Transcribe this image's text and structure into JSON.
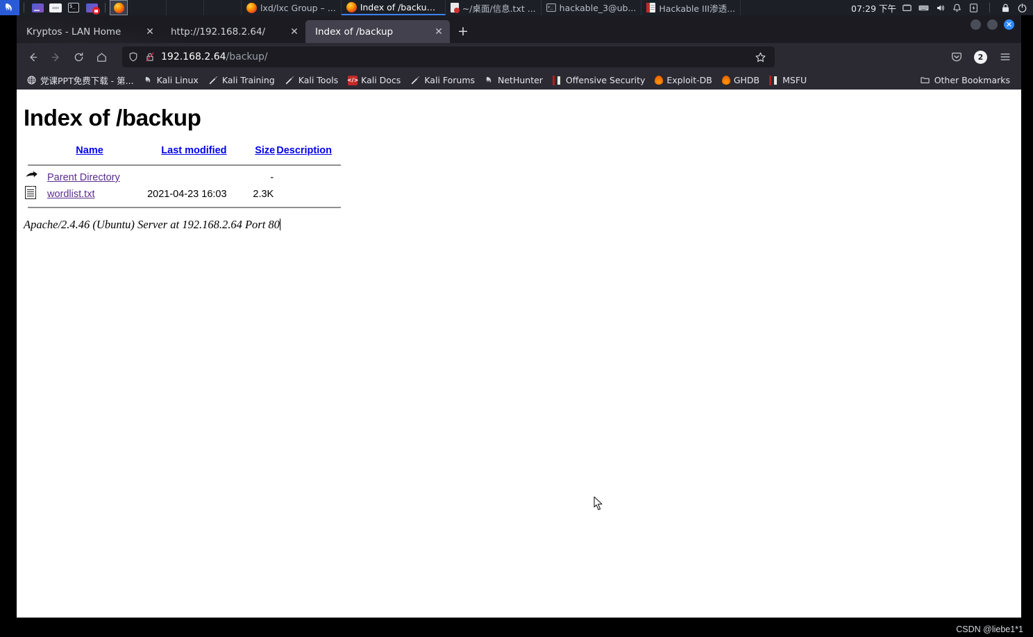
{
  "taskbar": {
    "menu_icon": "kali-dragon-icon",
    "launchers": [
      {
        "name": "file-manager",
        "icon": "files-icon"
      },
      {
        "name": "text-editor",
        "icon": "text-editor-icon"
      },
      {
        "name": "terminal",
        "icon": "terminal-icon"
      },
      {
        "name": "screen-recorder",
        "icon": "recorder-icon"
      },
      {
        "name": "firefox",
        "icon": "firefox-icon",
        "active": true
      }
    ],
    "windows": [
      {
        "label": "",
        "icon": "none",
        "empty": true
      },
      {
        "label": "",
        "icon": "none",
        "empty": true
      },
      {
        "label": "",
        "icon": "none",
        "empty": true
      },
      {
        "label": "lxd/lxc Group – ...",
        "icon": "firefox-icon",
        "active": false
      },
      {
        "label": "Index of /backup...",
        "icon": "firefox-icon",
        "active": true
      },
      {
        "label": "~/桌面/信息.txt ...",
        "icon": "pdf-icon",
        "active": false
      },
      {
        "label": "hackable_3@ub...",
        "icon": "terminal-icon",
        "active": false
      },
      {
        "label": "Hackable III渗透...",
        "icon": "document-icon",
        "active": false
      }
    ],
    "clock": "07:29 下午",
    "tray": [
      {
        "name": "network-icon"
      },
      {
        "name": "keyboard-icon"
      },
      {
        "name": "volume-icon"
      },
      {
        "name": "notifications-bell-icon"
      },
      {
        "name": "power-icon"
      },
      {
        "name": "lock-icon"
      },
      {
        "name": "logout-icon"
      }
    ]
  },
  "browser": {
    "tabs": [
      {
        "title": "Kryptos - LAN Home",
        "active": false,
        "close_label": "✕"
      },
      {
        "title": "http://192.168.2.64/",
        "active": false,
        "close_label": "✕"
      },
      {
        "title": "Index of /backup",
        "active": true,
        "close_label": "✕"
      }
    ],
    "new_tab_label": "+",
    "window_controls": {
      "minimize": "",
      "maximize": "",
      "close": "✕"
    },
    "nav": {
      "back_icon": "back-arrow-icon",
      "forward_icon": "forward-arrow-icon",
      "reload_icon": "reload-icon",
      "home_icon": "home-icon"
    },
    "url": {
      "shield_icon": "shield-icon",
      "lock_icon": "lock-crossed-icon",
      "domain": "192.168.2.64",
      "path": "/backup/",
      "star_icon": "bookmark-star-icon"
    },
    "nav_right": {
      "pocket_icon": "pocket-icon",
      "account_badge": "2",
      "menu_icon": "hamburger-menu-icon"
    },
    "bookmarks": [
      {
        "label": "党课PPT免费下载 - 第...",
        "icon": "globe-icon"
      },
      {
        "label": "Kali Linux",
        "icon": "kali-dragon-icon"
      },
      {
        "label": "Kali Training",
        "icon": "kali-tool-icon"
      },
      {
        "label": "Kali Tools",
        "icon": "kali-tool-icon"
      },
      {
        "label": "Kali Docs",
        "icon": "kali-docs-icon"
      },
      {
        "label": "Kali Forums",
        "icon": "kali-tool-icon"
      },
      {
        "label": "NetHunter",
        "icon": "kali-dragon-icon"
      },
      {
        "label": "Offensive Security",
        "icon": "book-icon"
      },
      {
        "label": "Exploit-DB",
        "icon": "flame-icon"
      },
      {
        "label": "GHDB",
        "icon": "flame-icon"
      },
      {
        "label": "MSFU",
        "icon": "book-icon"
      }
    ],
    "other_bookmarks": {
      "label": "Other Bookmarks",
      "icon": "folder-icon"
    }
  },
  "page": {
    "title": "Index of /backup",
    "columns": [
      "Name",
      "Last modified",
      "Size",
      "Description"
    ],
    "rows": [
      {
        "icon": "parent-directory-icon",
        "name": "Parent Directory",
        "last_modified": "",
        "size": "-",
        "description": ""
      },
      {
        "icon": "text-file-icon",
        "name": "wordlist.txt",
        "last_modified": "2021-04-23 16:03",
        "size": "2.3K",
        "description": ""
      }
    ],
    "server_signature": "Apache/2.4.46 (Ubuntu) Server at 192.168.2.64 Port 80",
    "link_color": "#5b2d8e",
    "header_link_color": "#0000ee"
  },
  "watermark": "CSDN @liebe1*1"
}
